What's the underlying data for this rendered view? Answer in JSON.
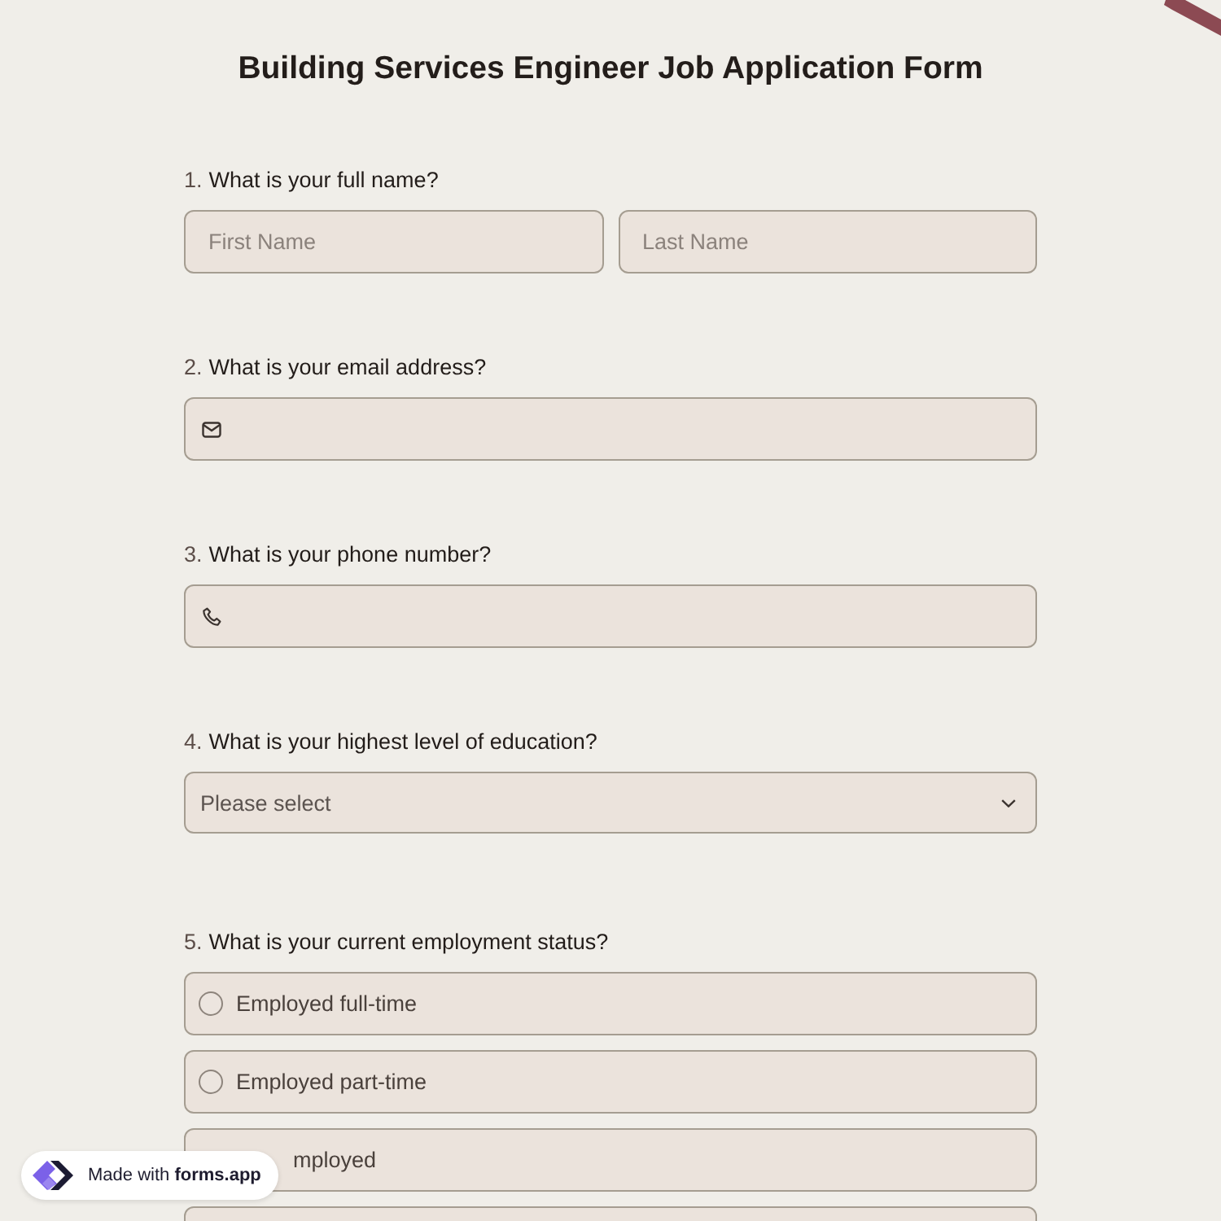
{
  "title": "Building Services Engineer Job Application Form",
  "questions": [
    {
      "number": "1.",
      "text": "What is your full name?",
      "kind": "name",
      "fields": [
        {
          "placeholder": "First Name"
        },
        {
          "placeholder": "Last Name"
        }
      ]
    },
    {
      "number": "2.",
      "text": "What is your email address?",
      "kind": "email"
    },
    {
      "number": "3.",
      "text": "What is your phone number?",
      "kind": "phone"
    },
    {
      "number": "4.",
      "text": "What is your highest level of education?",
      "kind": "select",
      "placeholder": "Please select"
    },
    {
      "number": "5.",
      "text": "What is your current employment status?",
      "kind": "radio",
      "options": [
        {
          "kind": "option",
          "label": "Employed full-time",
          "selected": false
        },
        {
          "kind": "option",
          "label": "Employed part-time",
          "selected": false
        },
        {
          "kind": "covered",
          "label": "mployed"
        },
        {
          "kind": "cut-off"
        }
      ]
    }
  ],
  "badge": {
    "text": "Made with **forms.app**"
  }
}
